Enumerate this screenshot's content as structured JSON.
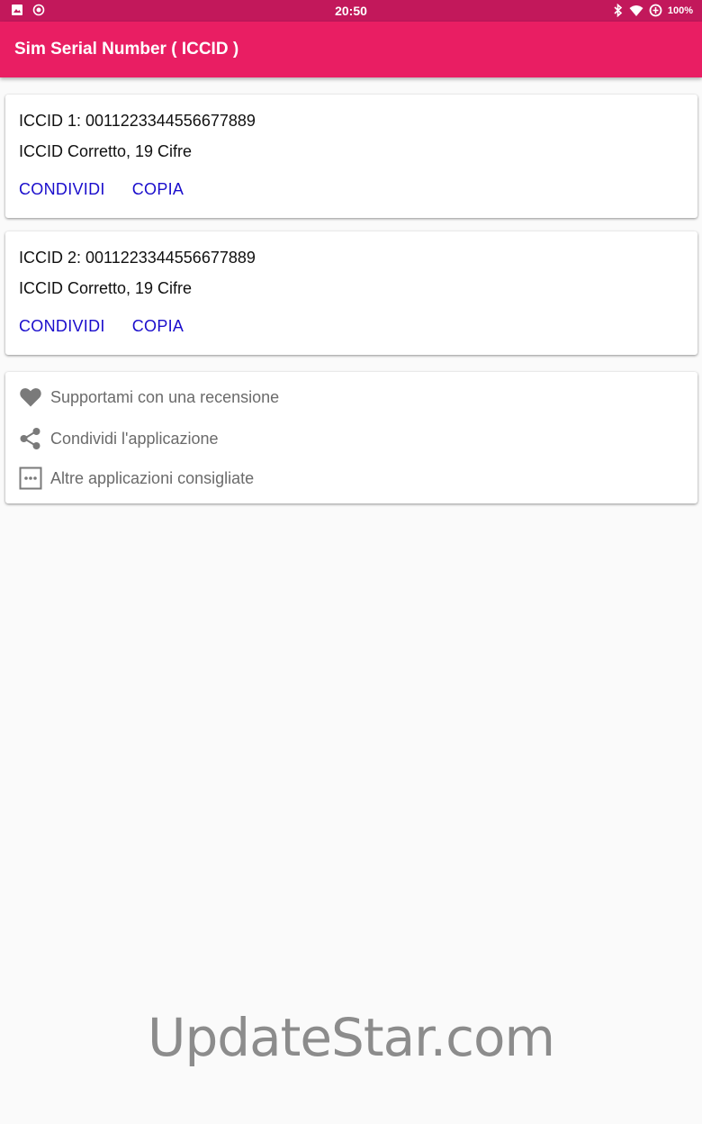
{
  "status_bar": {
    "time": "20:50",
    "battery": "100%",
    "left_icons": [
      "image-icon",
      "record-icon"
    ],
    "right_icons": [
      "bluetooth-icon",
      "wifi-icon",
      "data-saver-icon"
    ]
  },
  "app_bar": {
    "title": "Sim Serial Number ( ICCID )",
    "color": "#e91e63",
    "status_color": "#c2185b"
  },
  "sims": [
    {
      "iccid_line": "ICCID 1: 0011223344556677889",
      "status": "ICCID Corretto, 19 Cifre",
      "share_label": "CONDIVIDI",
      "copy_label": "COPIA"
    },
    {
      "iccid_line": "ICCID 2: 0011223344556677889",
      "status": "ICCID Corretto, 19 Cifre",
      "share_label": "CONDIVIDI",
      "copy_label": "COPIA"
    }
  ],
  "menu": [
    {
      "icon": "heart-icon",
      "label": "Supportami con una recensione"
    },
    {
      "icon": "share-icon",
      "label": "Condividi l'applicazione"
    },
    {
      "icon": "more-apps-icon",
      "label": "Altre applicazioni consigliate"
    }
  ],
  "watermark": "UpdateStar.com",
  "colors": {
    "link": "#1a0dcc",
    "menu_text": "#6b6b6b",
    "background": "#fafafa"
  }
}
